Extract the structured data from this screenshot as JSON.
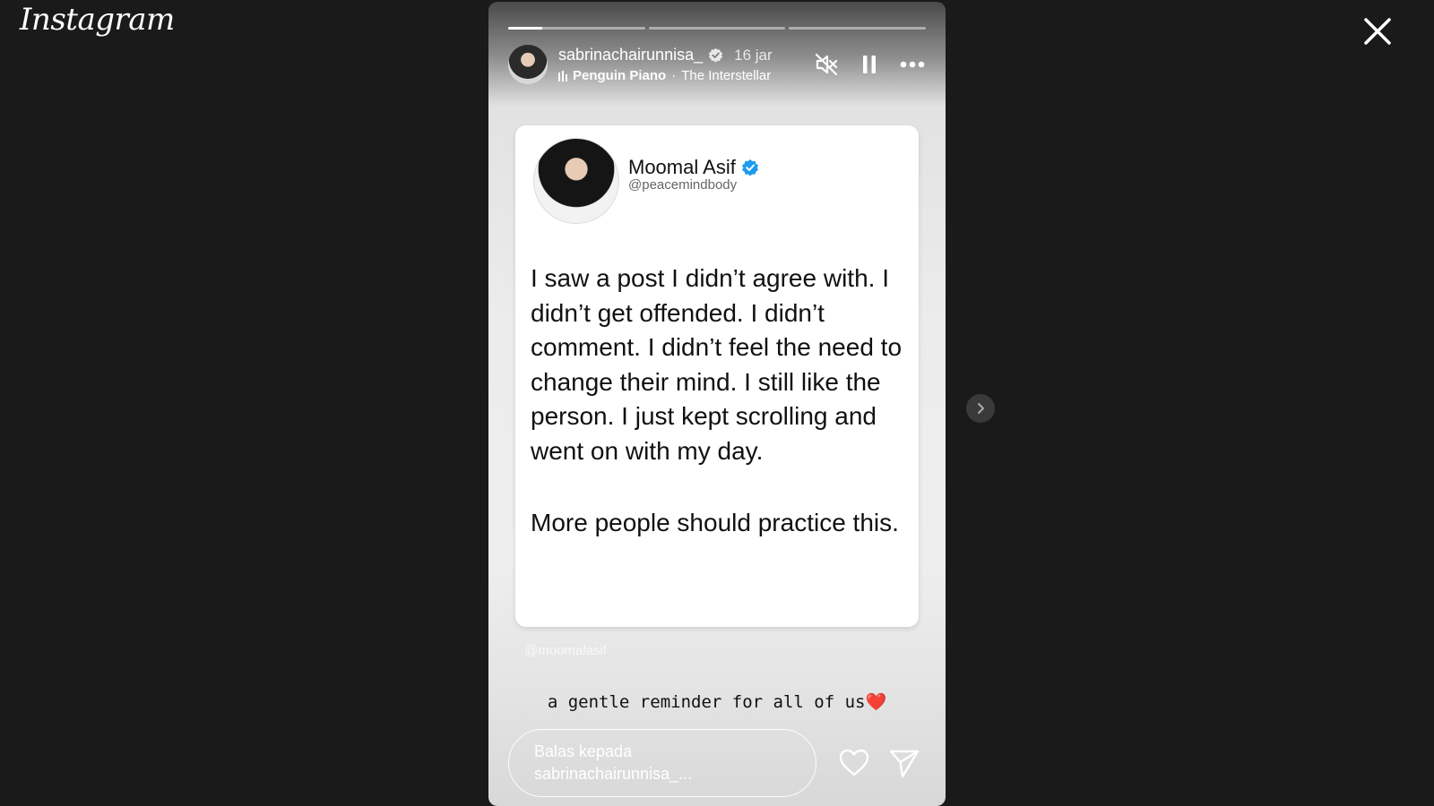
{
  "app": {
    "logo": "Instagram"
  },
  "story": {
    "progress": [
      0.25,
      0,
      0
    ],
    "user": {
      "username": "sabrinachairunnisa_",
      "time": "16 jar"
    },
    "music": {
      "artist": "Penguin Piano",
      "separator": "·",
      "title": "The Interstellar"
    },
    "controls": {
      "mute_icon": "speaker-muted-icon",
      "pause_icon": "pause-icon",
      "more_icon": "more-dots-icon"
    },
    "card": {
      "name": "Moomal Asif",
      "handle": "@peacemindbody",
      "paragraph1": "I saw a post I didn’t agree with. I didn’t get offended. I didn’t comment. I didn’t feel the need to change their mind. I still like the person. I just kept scrolling and went on with my day.",
      "paragraph2": "More people should practice this."
    },
    "watermark": "@moomalasif",
    "caption": "a gentle reminder for all of us",
    "caption_emoji": "❤️",
    "reply": {
      "line1": "Balas kepada",
      "line2": "sabrinachairunnisa_..."
    }
  },
  "colors": {
    "background": "#1a1a1a",
    "verified": "#1d9bf0",
    "heart": "#d8202f"
  }
}
